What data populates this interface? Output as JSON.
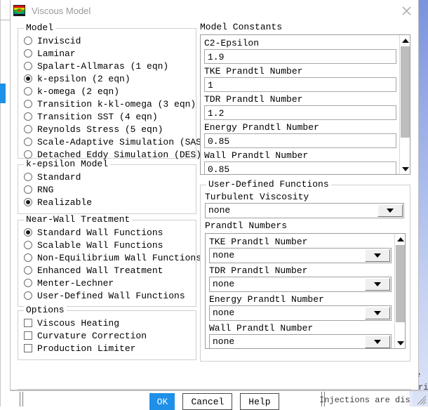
{
  "window": {
    "title": "Viscous Model",
    "icon": "contour-plot-icon",
    "close_icon": "close-icon"
  },
  "model_group": {
    "legend": "Model",
    "options": [
      {
        "label": "Inviscid",
        "selected": false
      },
      {
        "label": "Laminar",
        "selected": false
      },
      {
        "label": "Spalart-Allmaras (1 eqn)",
        "selected": false
      },
      {
        "label": "k-epsilon (2 eqn)",
        "selected": true
      },
      {
        "label": "k-omega (2 eqn)",
        "selected": false
      },
      {
        "label": "Transition k-kl-omega (3 eqn)",
        "selected": false
      },
      {
        "label": "Transition SST (4 eqn)",
        "selected": false
      },
      {
        "label": "Reynolds Stress (5 eqn)",
        "selected": false
      },
      {
        "label": "Scale-Adaptive Simulation (SAS)",
        "selected": false
      },
      {
        "label": "Detached Eddy Simulation (DES)",
        "selected": false
      }
    ]
  },
  "kepsilon_group": {
    "legend": "k-epsilon Model",
    "options": [
      {
        "label": "Standard",
        "selected": false
      },
      {
        "label": "RNG",
        "selected": false
      },
      {
        "label": "Realizable",
        "selected": true
      }
    ]
  },
  "nearwall_group": {
    "legend": "Near-Wall Treatment",
    "options": [
      {
        "label": "Standard Wall Functions",
        "selected": true
      },
      {
        "label": "Scalable Wall Functions",
        "selected": false
      },
      {
        "label": "Non-Equilibrium Wall Functions",
        "selected": false
      },
      {
        "label": "Enhanced Wall Treatment",
        "selected": false
      },
      {
        "label": "Menter-Lechner",
        "selected": false
      },
      {
        "label": "User-Defined Wall Functions",
        "selected": false
      }
    ]
  },
  "options_group": {
    "legend": "Options",
    "options": [
      {
        "label": "Viscous Heating",
        "checked": false
      },
      {
        "label": "Curvature Correction",
        "checked": false
      },
      {
        "label": "Production Limiter",
        "checked": false
      }
    ]
  },
  "model_constants": {
    "legend": "Model Constants",
    "fields": [
      {
        "label": "C2-Epsilon",
        "value": "1.9"
      },
      {
        "label": "TKE Prandtl Number",
        "value": "1"
      },
      {
        "label": "TDR Prandtl Number",
        "value": "1.2"
      },
      {
        "label": "Energy Prandtl Number",
        "value": "0.85"
      },
      {
        "label": "Wall Prandtl Number",
        "value": "0.85"
      }
    ],
    "scrollbar": {
      "up_icon": "scroll-up-arrow-icon",
      "down_icon": "scroll-down-arrow-icon"
    }
  },
  "udf_group": {
    "legend": "User-Defined Functions",
    "turbulent_viscosity": {
      "label": "Turbulent Viscosity",
      "value": "none"
    },
    "prandtl_numbers": {
      "legend": "Prandtl Numbers",
      "fields": [
        {
          "label": "TKE Prandtl Number",
          "value": "none"
        },
        {
          "label": "TDR Prandtl Number",
          "value": "none"
        },
        {
          "label": "Energy Prandtl Number",
          "value": "none"
        },
        {
          "label": "Wall Prandtl Number",
          "value": "none"
        }
      ]
    }
  },
  "footer": {
    "ok": "OK",
    "cancel": "Cancel",
    "help": "Help"
  },
  "background": {
    "status_text": "Injections are dis",
    "right_text_a": "e",
    "right_text_b": "ri"
  },
  "colors": {
    "accent": "#1e90e8",
    "title_text": "#9a9a9a",
    "group_border": "#cfcfcf",
    "scroll_thumb": "#bdbdbd"
  }
}
